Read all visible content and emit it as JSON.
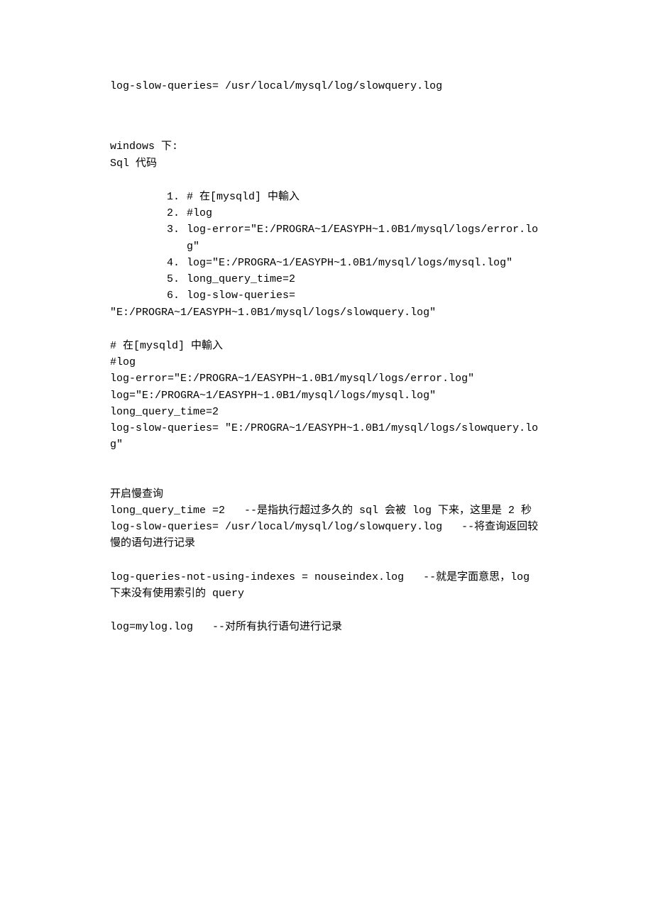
{
  "top_line": "log-slow-queries= /usr/local/mysql/log/slowquery.log",
  "win_heading": "windows 下:",
  "sql_label": "Sql 代码",
  "code_list": [
    "# 在[mysqld] 中輸入",
    "#log",
    "log-error=\"E:/PROGRA~1/EASYPH~1.0B1/mysql/logs/error.log\"",
    "log=\"E:/PROGRA~1/EASYPH~1.0B1/mysql/logs/mysql.log\"",
    "long_query_time=2",
    "log-slow-queries="
  ],
  "code_list_cont": "\"E:/PROGRA~1/EASYPH~1.0B1/mysql/logs/slowquery.log\"",
  "block2": {
    "l1": "# 在[mysqld] 中輸入",
    "l2": "#log",
    "l3": "log-error=\"E:/PROGRA~1/EASYPH~1.0B1/mysql/logs/error.log\"",
    "l4": "log=\"E:/PROGRA~1/EASYPH~1.0B1/mysql/logs/mysql.log\"",
    "l5": "long_query_time=2",
    "l6": "log-slow-queries= \"E:/PROGRA~1/EASYPH~1.0B1/mysql/logs/slowquery.log\""
  },
  "slow_heading": "开启慢查询",
  "slow": {
    "l1": "long_query_time =2   --是指执行超过多久的 sql 会被 log 下来，这里是 2 秒",
    "l2": "log-slow-queries= /usr/local/mysql/log/slowquery.log   --将查询返回较慢的语句进行记录",
    "l3": "log-queries-not-using-indexes = nouseindex.log   --就是字面意思，log 下来没有使用索引的 query",
    "l4": "log=mylog.log   --对所有执行语句进行记录"
  }
}
